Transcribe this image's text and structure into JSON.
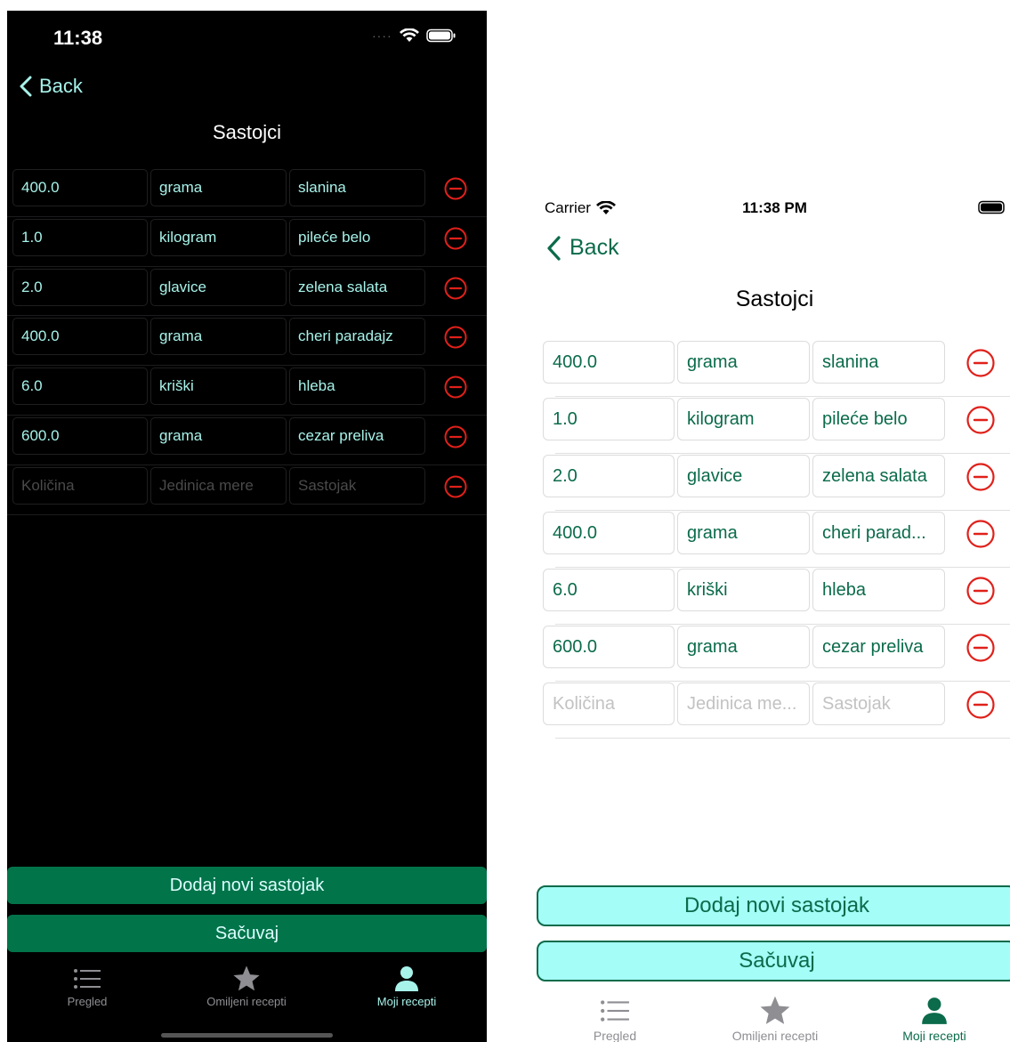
{
  "colors": {
    "accent_dark": "#a7f3ea",
    "accent_light": "#0b6b4b",
    "button_dark": "#02744a",
    "button_light": "#a4fdf6",
    "remove": "#e0201a"
  },
  "dark": {
    "status": {
      "time": "11:38"
    },
    "nav": {
      "back_label": "Back"
    },
    "title": "Sastojci",
    "ingredients": [
      {
        "amount": "400.0",
        "unit": "grama",
        "name": "slanina"
      },
      {
        "amount": "1.0",
        "unit": "kilogram",
        "name": "pileće belo"
      },
      {
        "amount": "2.0",
        "unit": "glavice",
        "name": "zelena salata"
      },
      {
        "amount": "400.0",
        "unit": "grama",
        "name": "cheri paradajz"
      },
      {
        "amount": "6.0",
        "unit": "kriški",
        "name": "hleba"
      },
      {
        "amount": "600.0",
        "unit": "grama",
        "name": "cezar preliva"
      }
    ],
    "placeholders": {
      "amount": "Količina",
      "unit": "Jedinica mere",
      "name": "Sastojak"
    },
    "buttons": {
      "add": "Dodaj novi sastojak",
      "save": "Sačuvaj"
    },
    "tabs": [
      "Pregled",
      "Omiljeni recepti",
      "Moji recepti"
    ]
  },
  "light": {
    "status": {
      "carrier": "Carrier",
      "time": "11:38 PM"
    },
    "nav": {
      "back_label": "Back"
    },
    "title": "Sastojci",
    "ingredients": [
      {
        "amount": "400.0",
        "unit": "grama",
        "name": "slanina"
      },
      {
        "amount": "1.0",
        "unit": "kilogram",
        "name": "pileće belo"
      },
      {
        "amount": "2.0",
        "unit": "glavice",
        "name": "zelena salata"
      },
      {
        "amount": "400.0",
        "unit": "grama",
        "name": "cheri parad..."
      },
      {
        "amount": "6.0",
        "unit": "kriški",
        "name": "hleba"
      },
      {
        "amount": "600.0",
        "unit": "grama",
        "name": "cezar preliva"
      }
    ],
    "placeholders": {
      "amount": "Količina",
      "unit": "Jedinica me...",
      "name": "Sastojak"
    },
    "buttons": {
      "add": "Dodaj novi sastojak",
      "save": "Sačuvaj"
    },
    "tabs": [
      "Pregled",
      "Omiljeni recepti",
      "Moji recepti"
    ]
  }
}
